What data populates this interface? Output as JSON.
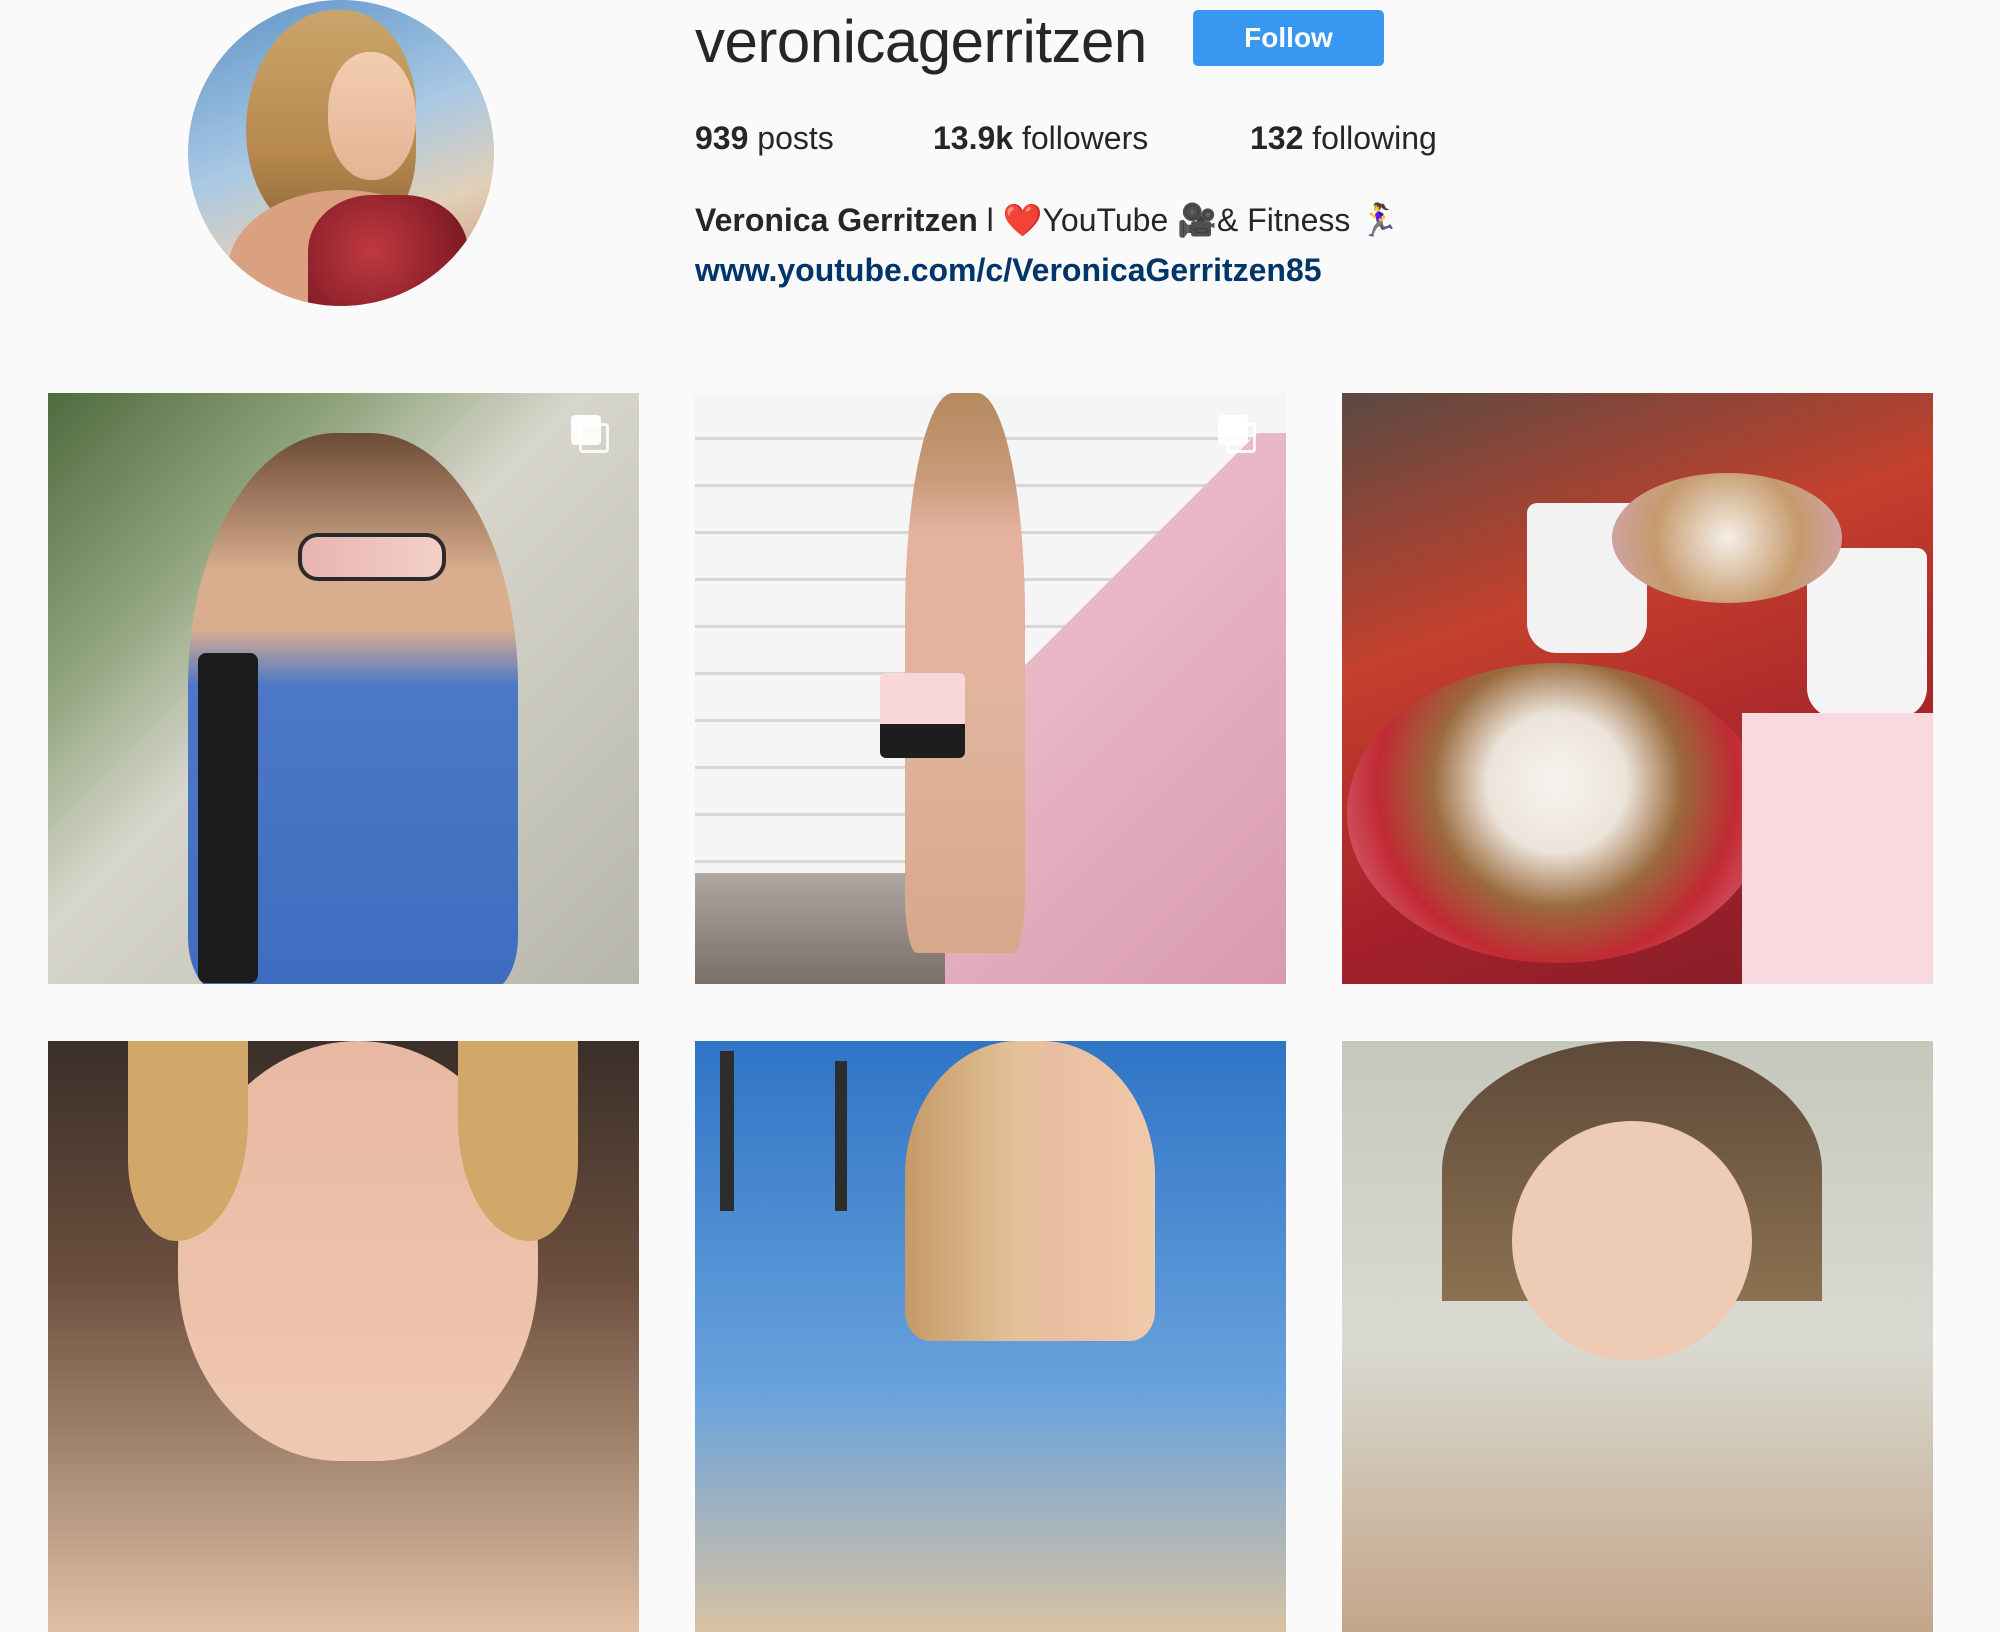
{
  "profile": {
    "username": "veronicagerritzen",
    "follow_label": "Follow",
    "stats": {
      "posts_count": "939",
      "posts_label": "posts",
      "followers_count": "13.9k",
      "followers_label": "followers",
      "following_count": "132",
      "following_label": "following"
    },
    "bio": {
      "full_name": "Veronica Gerritzen",
      "separator": " l ",
      "heart": "❤️",
      "youtube": "YouTube ",
      "camera": "🎥",
      "fitness": "& Fitness ",
      "runner": "🏃‍♀"
    },
    "website": "www.youtube.com/c/VeronicaGerritzen85"
  },
  "colors": {
    "accent": "#3897f0",
    "link": "#003569",
    "background": "#fafafa"
  },
  "posts": [
    {
      "type": "carousel",
      "icon": "multiple-images-icon"
    },
    {
      "type": "carousel",
      "icon": "multiple-images-icon"
    },
    {
      "type": "single"
    },
    {
      "type": "single"
    },
    {
      "type": "single"
    },
    {
      "type": "single"
    }
  ]
}
